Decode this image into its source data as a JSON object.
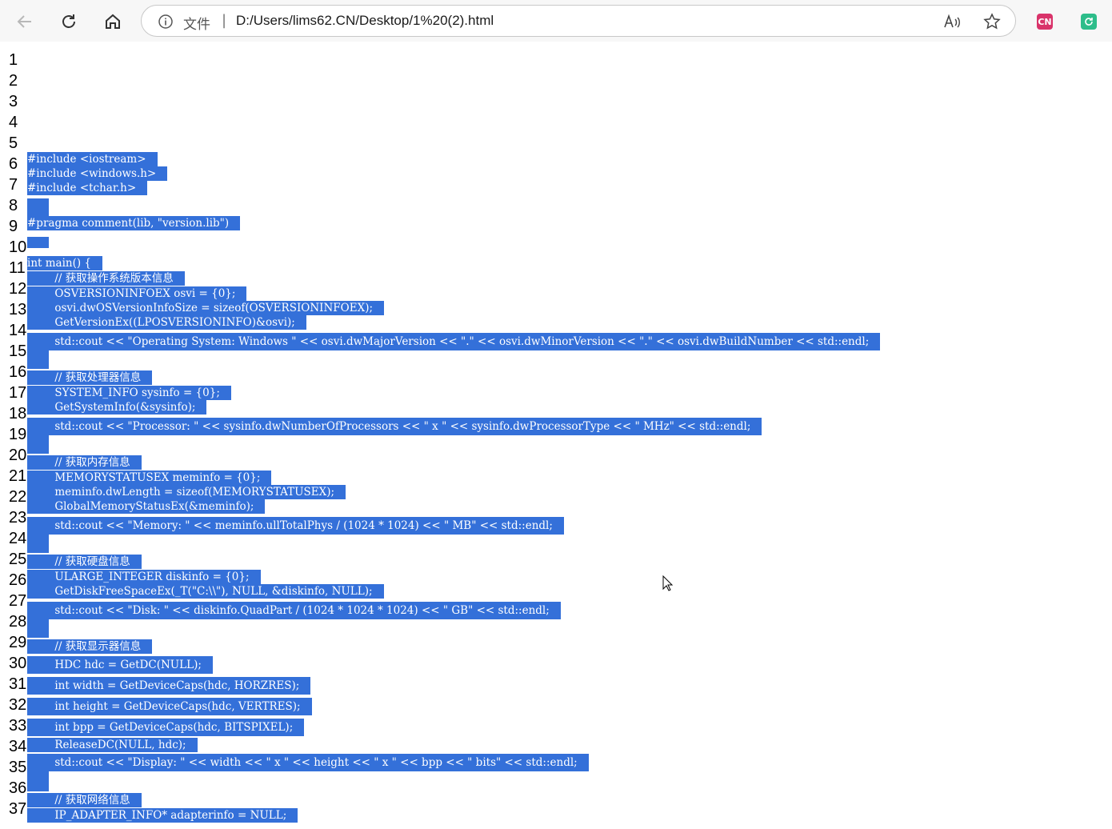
{
  "browser": {
    "address_label": "文件",
    "address_separator": "|",
    "url": "D:/Users/lims62.CN/Desktop/1%20(2).html",
    "extension_1_label": "CN",
    "extension_1_color": "#d9336a",
    "extension_2_color": "#2dbd8a",
    "icons": [
      "back-icon",
      "reload-icon",
      "home-icon",
      "info-icon",
      "read-aloud-icon",
      "favorite-star-icon",
      "translate-extension-icon",
      "sync-extension-icon"
    ]
  },
  "line_numbers": [
    "1",
    "2",
    "3",
    "4",
    "5",
    "6",
    "7",
    "8",
    "9",
    "10",
    "11",
    "12",
    "13",
    "14",
    "15",
    "16",
    "17",
    "18",
    "19",
    "20",
    "21",
    "22",
    "23",
    "24",
    "25",
    "26",
    "27",
    "28",
    "29",
    "30",
    "31",
    "32",
    "33",
    "34",
    "35",
    "36",
    "37"
  ],
  "code_lines": [
    "#include <iostream>",
    "#include <windows.h>",
    "#include <tchar.h>",
    "#pragma comment(lib, \"version.lib\")",
    "int main() {",
    "        // 获取操作系统版本信息",
    "        OSVERSIONINFOEX osvi = {0};",
    "        osvi.dwOSVersionInfoSize = sizeof(OSVERSIONINFOEX);",
    "        GetVersionEx((LPOSVERSIONINFO)&osvi);",
    "        std::cout << \"Operating System: Windows \" << osvi.dwMajorVersion << \".\" << osvi.dwMinorVersion << \".\" << osvi.dwBuildNumber << std::endl;",
    "        // 获取处理器信息",
    "        SYSTEM_INFO sysinfo = {0};",
    "        GetSystemInfo(&sysinfo);",
    "        std::cout << \"Processor: \" << sysinfo.dwNumberOfProcessors << \" x \" << sysinfo.dwProcessorType << \" MHz\" << std::endl;",
    "        // 获取内存信息",
    "        MEMORYSTATUSEX meminfo = {0};",
    "        meminfo.dwLength = sizeof(MEMORYSTATUSEX);",
    "        GlobalMemoryStatusEx(&meminfo);",
    "        std::cout << \"Memory: \" << meminfo.ullTotalPhys / (1024 * 1024) << \" MB\" << std::endl;",
    "        // 获取硬盘信息",
    "        ULARGE_INTEGER diskinfo = {0};",
    "        GetDiskFreeSpaceEx(_T(\"C:\\\\\"), NULL, &diskinfo, NULL);",
    "        std::cout << \"Disk: \" << diskinfo.QuadPart / (1024 * 1024 * 1024) << \" GB\" << std::endl;",
    "        // 获取显示器信息",
    "        HDC hdc = GetDC(NULL);",
    "        int width = GetDeviceCaps(hdc, HORZRES);",
    "        int height = GetDeviceCaps(hdc, VERTRES);",
    "        int bpp = GetDeviceCaps(hdc, BITSPIXEL);",
    "        ReleaseDC(NULL, hdc);",
    "        std::cout << \"Display: \" << width << \" x \" << height << \" x \" << bpp << \" bits\" << std::endl;",
    "        // 获取网络信息",
    "        IP_ADAPTER_INFO* adapterinfo = NULL;"
  ],
  "selection_color": "#3470d9"
}
